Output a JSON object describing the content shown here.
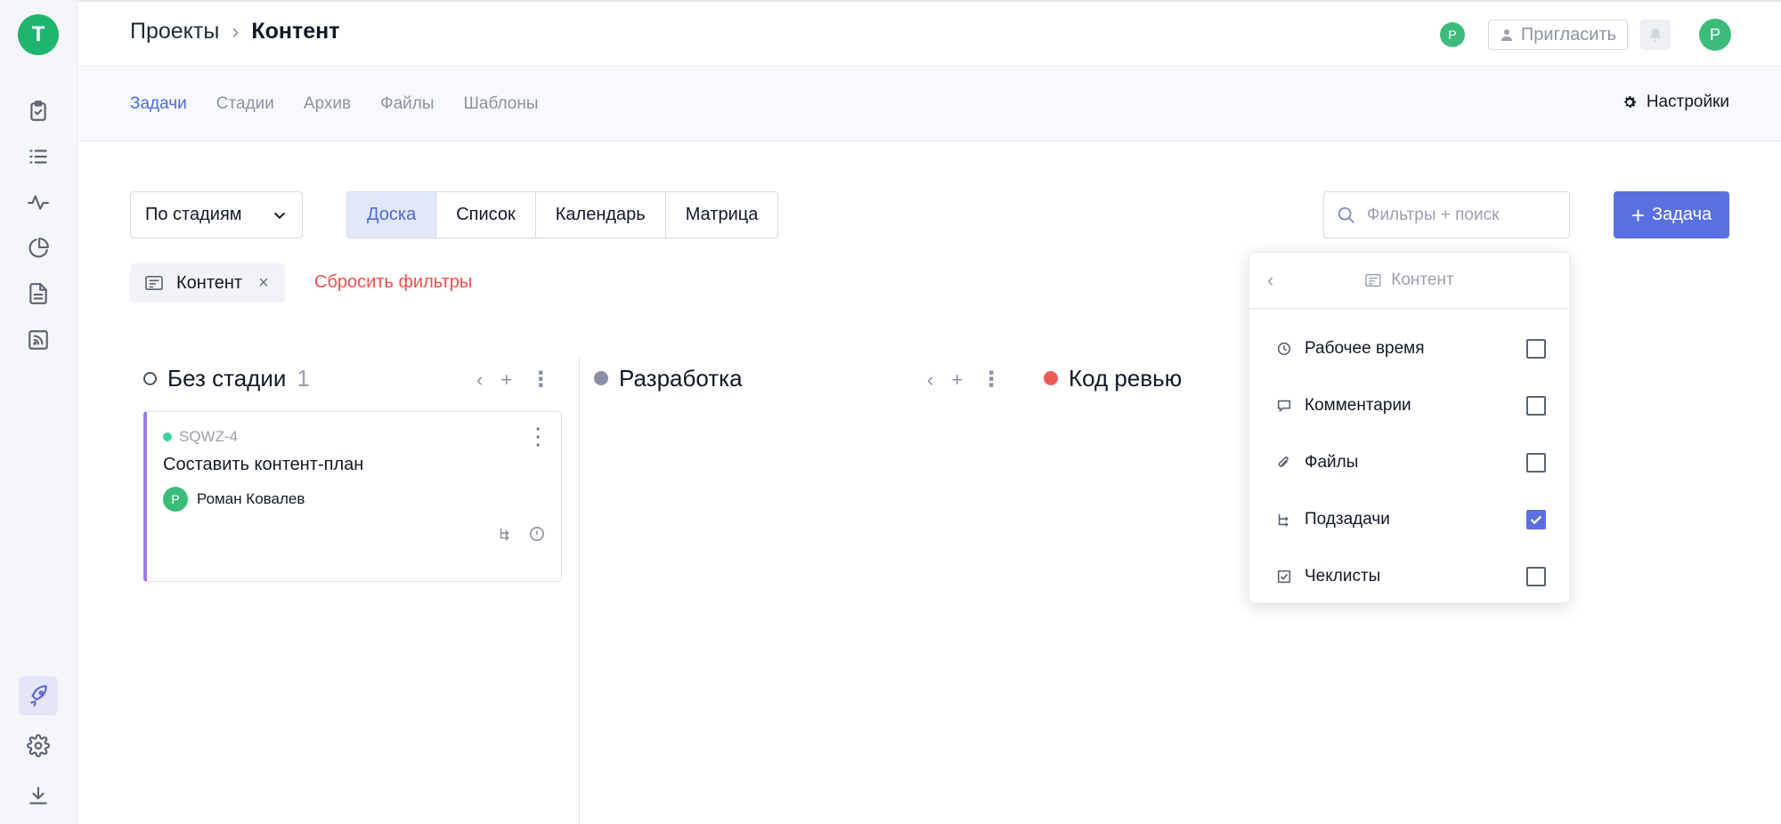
{
  "rail": {
    "logo_letter": "T",
    "items": [
      "tasks-icon",
      "list-icon",
      "activity-icon",
      "pie-chart-icon",
      "document-icon",
      "rss-icon"
    ],
    "bottom": [
      "rocket-icon",
      "gear-icon",
      "download-icon"
    ]
  },
  "header": {
    "breadcrumb_root": "Проекты",
    "breadcrumb_sep": "›",
    "breadcrumb_current": "Контент",
    "avatar_small": "P",
    "invite_label": "Пригласить",
    "avatar_user": "P"
  },
  "tabs": {
    "items": [
      "Задачи",
      "Стадии",
      "Архив",
      "Файлы",
      "Шаблоны"
    ],
    "active": "Задачи",
    "settings_label": "Настройки"
  },
  "toolbar": {
    "grouping_value": "По стадиям",
    "views": [
      "Доска",
      "Список",
      "Календарь",
      "Матрица"
    ],
    "active_view": "Доска",
    "search_placeholder": "Фильтры + поиск",
    "add_task_label": "Задача"
  },
  "filters": {
    "chip_label": "Контент",
    "chip_close": "×",
    "reset_label": "Сбросить фильтры"
  },
  "board": {
    "columns": [
      {
        "name": "Без стадии",
        "count": "1",
        "dot_color": "#ffffff"
      },
      {
        "name": "Разработка",
        "count": "",
        "dot_color": "#8b8fa3"
      },
      {
        "name": "Код ревью",
        "count": "",
        "dot_color": "#ef5b5b"
      }
    ],
    "card": {
      "key": "SQWZ-4",
      "title": "Составить контент-план",
      "assignee_initial": "P",
      "assignee_name": "Роман Ковалев",
      "accent_color": "#9b7cf0"
    }
  },
  "panel": {
    "title": "Контент",
    "back_glyph": "‹",
    "options": [
      {
        "label": "Рабочее время",
        "icon": "clock-icon",
        "checked": false
      },
      {
        "label": "Комментарии",
        "icon": "comment-icon",
        "checked": false
      },
      {
        "label": "Файлы",
        "icon": "paperclip-icon",
        "checked": false
      },
      {
        "label": "Подзадачи",
        "icon": "subtask-icon",
        "checked": true
      },
      {
        "label": "Чеклисты",
        "icon": "checklist-icon",
        "checked": false
      }
    ]
  },
  "colors": {
    "brand_green": "#1fb56f",
    "accent_blue": "#5a6fe0",
    "reset_red": "#ef4f4f"
  }
}
